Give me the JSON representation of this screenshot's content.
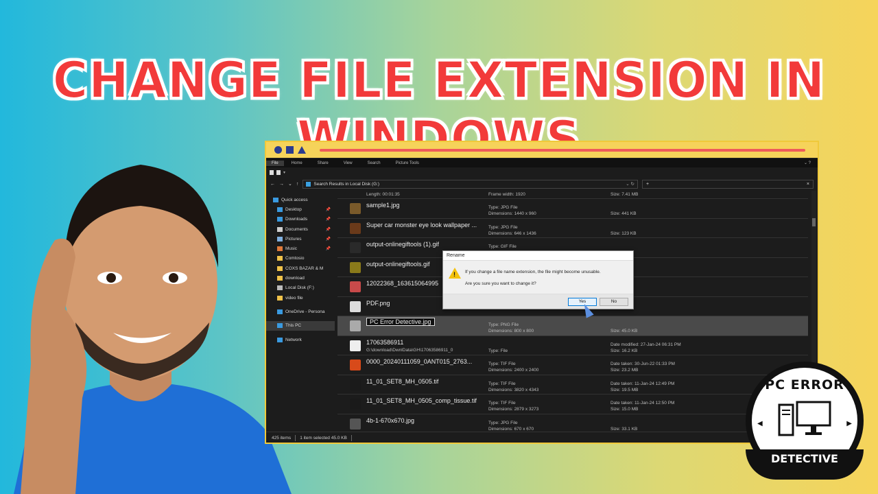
{
  "headline": "CHANGE FILE EXTENSION IN WINDOWS",
  "colors": {
    "headline": "#f23a3a",
    "accent_bar": "#ef5a5a",
    "window_frame": "#f0c93a",
    "explorer_bg": "#1c1c1c"
  },
  "ribbon": {
    "tabs": [
      "File",
      "Home",
      "Share",
      "View",
      "Search",
      "Picture Tools"
    ]
  },
  "navbar": {
    "address": "Search Results in Local Disk (G:)",
    "search_value": "+",
    "search_clear": "×"
  },
  "sidebar": {
    "items": [
      {
        "label": "Quick access",
        "icon": "star-icon"
      },
      {
        "label": "Desktop",
        "icon": "desktop-folder-icon",
        "pin": "📌"
      },
      {
        "label": "Downloads",
        "icon": "download-folder-icon",
        "pin": "📌"
      },
      {
        "label": "Documents",
        "icon": "documents-folder-icon",
        "pin": "📌"
      },
      {
        "label": "Pictures",
        "icon": "pictures-folder-icon",
        "pin": "📌"
      },
      {
        "label": "Music",
        "icon": "music-folder-icon",
        "pin": "📌"
      },
      {
        "label": "Comtosio",
        "icon": "folder-icon"
      },
      {
        "label": "COXS BAZAR & M",
        "icon": "folder-icon"
      },
      {
        "label": "download",
        "icon": "folder-icon"
      },
      {
        "label": "Local Disk (F:)",
        "icon": "drive-icon"
      },
      {
        "label": "video file",
        "icon": "folder-icon"
      },
      {
        "label": "OneDrive - Persona",
        "icon": "cloud-icon"
      },
      {
        "label": "This PC",
        "icon": "computer-icon"
      },
      {
        "label": "Network",
        "icon": "network-icon"
      }
    ]
  },
  "top_row": {
    "left": "Length: 00:01:35",
    "mid": "Frame width: 1920",
    "right": "Size: 7.41 MB"
  },
  "files": [
    {
      "name": "sample1.jpg",
      "sub": "",
      "c2a": "Type: JPG File",
      "c2b": "Dimensions: 1440 x 960",
      "c3a": "",
      "c3b": "Size: 441 KB",
      "thumb": "#7a5a2a"
    },
    {
      "name": "Super car monster eye look wallpaper ...",
      "sub": "",
      "c2a": "Type: JPG File",
      "c2b": "Dimensions: 646 x 1436",
      "c3a": "",
      "c3b": "Size: 123 KB",
      "thumb": "#6a3a1a"
    },
    {
      "name": "output-onlinegiftools (1).gif",
      "sub": "",
      "c2a": "Type: GIF File",
      "c2b": "",
      "c3a": "",
      "c3b": "",
      "thumb": "#2a2a2a"
    },
    {
      "name": "output-onlinegiftools.gif",
      "sub": "",
      "c2a": "",
      "c2b": "",
      "c3a": "",
      "c3b": "",
      "thumb": "#8a7a1a"
    },
    {
      "name": "12022368_163615064995",
      "sub": "",
      "c2a": "",
      "c2b": "",
      "c3a": "",
      "c3b": "",
      "thumb": "#c84a4a"
    },
    {
      "name": "PDF.png",
      "sub": "",
      "c2a": "",
      "c2b": "",
      "c3a": "",
      "c3b": "",
      "thumb": "#dddddd"
    },
    {
      "name": "PC Error Detective.jpg",
      "sub": "",
      "c2a": "Type: PNG File",
      "c2b": "Dimensions: 800 x 800",
      "c3a": "",
      "c3b": "Size: 45.0 KB",
      "thumb": "#aaaaaa",
      "selected": true
    },
    {
      "name": "17063586911",
      "sub": "G:\\download\\DwnlData\\GH\\17063586911_0",
      "c2a": "",
      "c2b": "Type: File",
      "c3a": "Date modified: 27-Jan-24 06:31 PM",
      "c3b": "Size: 16.2 KB",
      "thumb": "#eeeeee"
    },
    {
      "name": "0000_20240111059_0ANT015_2763...",
      "sub": "",
      "c2a": "Type: TIF File",
      "c2b": "Dimensions: 2400 x 2400",
      "c3a": "Date taken: 30-Jun-22 01:33 PM",
      "c3b": "Size: 23.2 MB",
      "thumb": "#d84a1a"
    },
    {
      "name": "11_01_SET8_MH_0505.tif",
      "sub": "",
      "c2a": "Type: TIF File",
      "c2b": "Dimensions: 3820 x 4343",
      "c3a": "Date taken: 11-Jan-24 12:49 PM",
      "c3b": "Size: 19.5 MB",
      "thumb": "#1a1a1a"
    },
    {
      "name": "11_01_SET8_MH_0505_comp_tissue.tif",
      "sub": "",
      "c2a": "Type: TIF File",
      "c2b": "Dimensions: 2879 x 3273",
      "c3a": "Date taken: 11-Jan-24 12:50 PM",
      "c3b": "Size: 15.0 MB",
      "thumb": "#1a1a1a"
    },
    {
      "name": "4b-1-670x670.jpg",
      "sub": "",
      "c2a": "Type: JPG File",
      "c2b": "Dimensions: 670 x 670",
      "c3a": "",
      "c3b": "Size: 33.1 KB",
      "thumb": "#555555"
    }
  ],
  "status": {
    "count": "425 items",
    "selected": "1 item selected  45.0 KB"
  },
  "dialog": {
    "title": "Rename",
    "message1": "If you change a file name extension, the file might become unusable.",
    "message2": "Are you sure you want to change it?",
    "yes": "Yes",
    "no": "No"
  },
  "logo": {
    "top": "PC ERROR",
    "bottom": "DETECTIVE"
  }
}
